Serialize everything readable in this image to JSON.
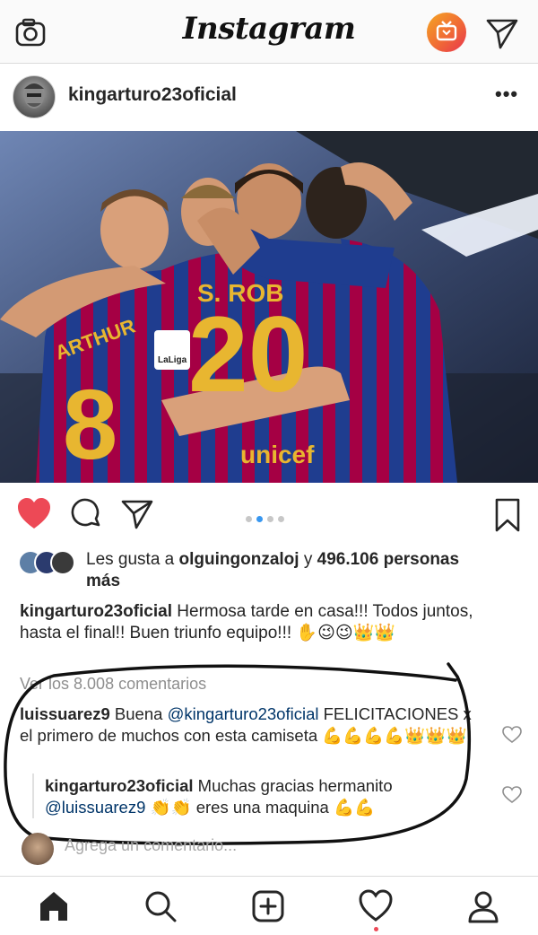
{
  "header": {
    "logo": "Instagram",
    "icons": [
      "camera-icon",
      "igtv-icon",
      "direct-send-icon"
    ]
  },
  "post": {
    "username": "kingarturo23oficial",
    "more_label": "•••",
    "photo": {
      "jersey_name": "S. ROB",
      "jersey_number": "20",
      "jersey_name_2": "ARTHUR",
      "jersey_number_2": "8",
      "sponsor": "unicef",
      "patch": "LaLiga"
    },
    "carousel": {
      "count": 4,
      "active_index": 1
    },
    "likes": {
      "prefix": "Les gusta a ",
      "user": "olguingonzaloj",
      "middle": " y ",
      "count": "496.106 personas",
      "suffix": "más"
    },
    "caption": {
      "username": "kingarturo23oficial",
      "text": "Hermosa tarde en casa!!! Todos juntos, hasta el final!! Buen triunfo equipo!!! ✋😉😉👑👑"
    },
    "view_comments": "Ver los 8.008 comentarios",
    "comments": [
      {
        "username": "luissuarez9",
        "pre": "Buena ",
        "mention": "@kingarturo23oficial",
        "text": " FELICITACIONES x el primero de muchos con esta camiseta 💪💪💪💪👑👑👑"
      },
      {
        "username": "kingarturo23oficial",
        "pre": "Muchas gracias hermanito ",
        "mention": "@luissuarez9",
        "text": " 👏👏 eres una maquina 💪💪"
      }
    ],
    "add_comment_placeholder": "Agrega un comentario..."
  },
  "colors": {
    "like_red": "#ed4956",
    "mention_blue": "#003569",
    "link_blue": "#3897f0",
    "jersey_blue": "#1f3d8f",
    "jersey_red": "#a50044",
    "gold": "#e8b630"
  },
  "bottom_nav": [
    "home-icon",
    "search-icon",
    "new-post-icon",
    "activity-heart-icon",
    "profile-icon"
  ]
}
